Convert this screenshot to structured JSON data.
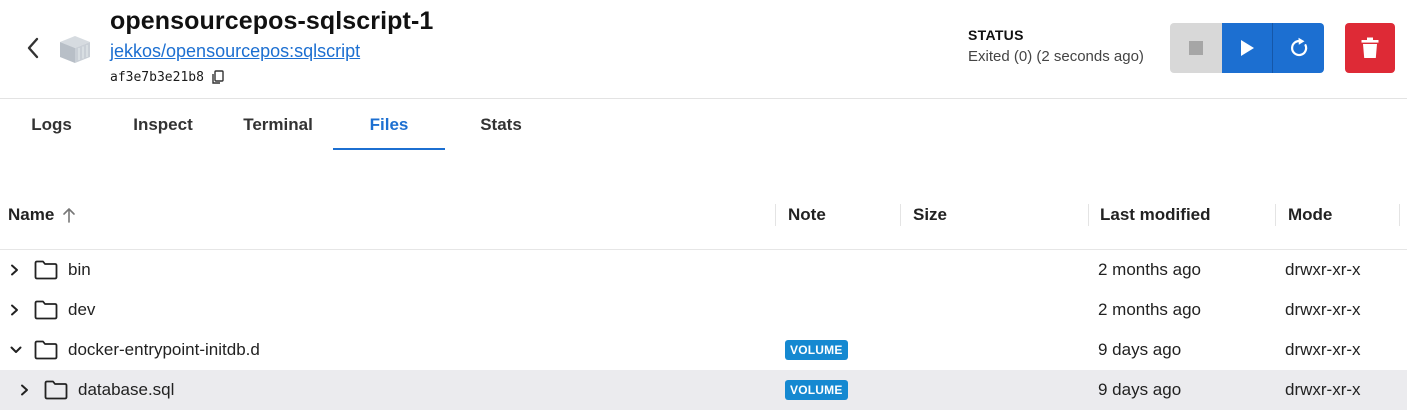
{
  "header": {
    "title": "opensourcepos-sqlscript-1",
    "image": "jekkos/opensourcepos:sqlscript",
    "container_id": "af3e7b3e21b8",
    "status_label": "STATUS",
    "status_value": "Exited (0) (2 seconds ago)"
  },
  "colors": {
    "accent": "#1c6fd1",
    "danger": "#de2a36",
    "badge": "#1589d1",
    "disabled": "#d8d8d8"
  },
  "icons": {
    "back": "chevron-left-icon",
    "container": "container-cube-icon",
    "copy": "copy-icon",
    "stop": "stop-icon",
    "start": "play-icon",
    "restart": "restart-icon",
    "delete": "trash-icon"
  },
  "tabs": [
    {
      "label": "Logs",
      "active": false
    },
    {
      "label": "Inspect",
      "active": false
    },
    {
      "label": "Terminal",
      "active": false
    },
    {
      "label": "Files",
      "active": true
    },
    {
      "label": "Stats",
      "active": false
    }
  ],
  "table": {
    "columns": [
      "Name",
      "Note",
      "Size",
      "Last modified",
      "Mode"
    ],
    "sort": {
      "column": "Name",
      "direction": "ascending"
    },
    "rows": [
      {
        "name": "bin",
        "note": "",
        "size": "",
        "modified": "2 months ago",
        "mode": "drwxr-xr-x",
        "expanded": false,
        "level": 0,
        "selected": false
      },
      {
        "name": "dev",
        "note": "",
        "size": "",
        "modified": "2 months ago",
        "mode": "drwxr-xr-x",
        "expanded": false,
        "level": 0,
        "selected": false
      },
      {
        "name": "docker-entrypoint-initdb.d",
        "note": "VOLUME",
        "size": "",
        "modified": "9 days ago",
        "mode": "drwxr-xr-x",
        "expanded": true,
        "level": 0,
        "selected": false
      },
      {
        "name": "database.sql",
        "note": "VOLUME",
        "size": "",
        "modified": "9 days ago",
        "mode": "drwxr-xr-x",
        "expanded": false,
        "level": 1,
        "selected": true
      }
    ]
  }
}
